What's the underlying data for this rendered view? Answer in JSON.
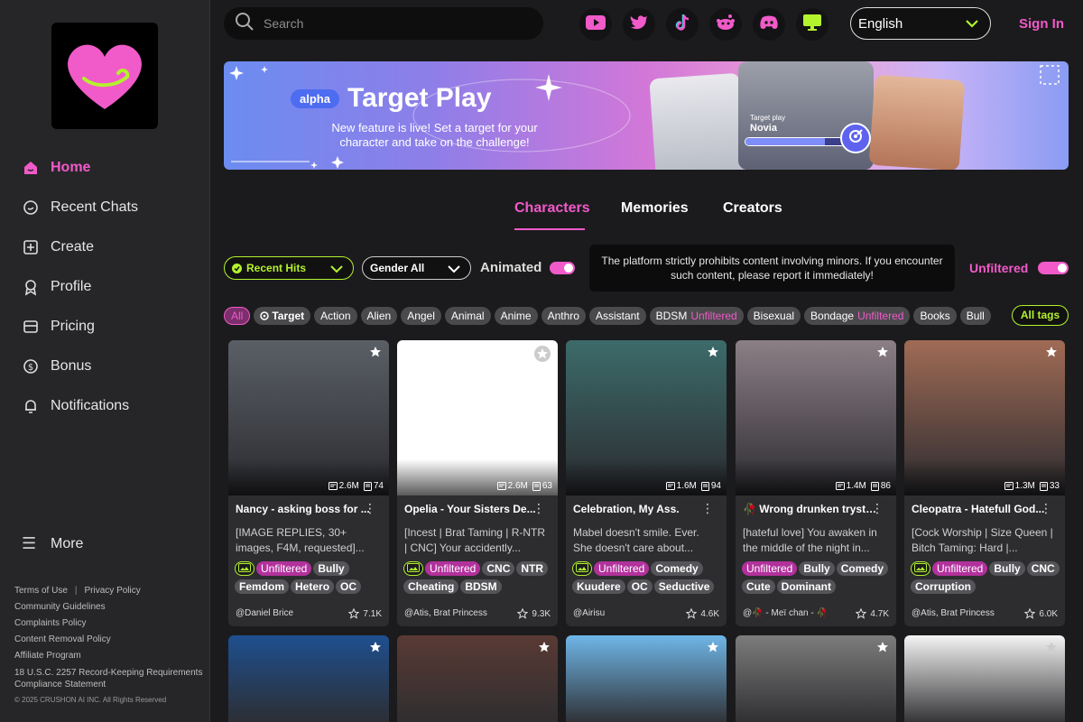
{
  "search": {
    "placeholder": "Search"
  },
  "sidebar": {
    "items": [
      {
        "label": "Home",
        "icon": "home-icon",
        "active": true
      },
      {
        "label": "Recent Chats",
        "icon": "chat-icon"
      },
      {
        "label": "Create",
        "icon": "plus-square-icon"
      },
      {
        "label": "Profile",
        "icon": "profile-icon"
      },
      {
        "label": "Pricing",
        "icon": "card-icon"
      },
      {
        "label": "Bonus",
        "icon": "dollar-icon"
      },
      {
        "label": "Notifications",
        "icon": "bell-icon"
      }
    ],
    "more_label": "More",
    "footer": {
      "terms": "Terms of Use",
      "privacy": "Privacy Policy",
      "guidelines": "Community Guidelines",
      "complaints": "Complaints Policy",
      "removal": "Content Removal Policy",
      "affiliate": "Affiliate Program",
      "usc": "18 U.S.C. 2257 Record-Keeping Requirements Compliance Statement",
      "copyright": "© 2025 CRUSHON AI INC. All Rights Reserved"
    }
  },
  "header": {
    "language": "English",
    "signin_label": "Sign In",
    "socials": [
      "youtube-icon",
      "twitter-icon",
      "tiktok-icon",
      "reddit-icon",
      "discord-icon",
      "desktop-icon"
    ]
  },
  "banner": {
    "badge": "alpha",
    "title": "Target Play",
    "subtitle": "New feature is live! Set a target for your character and take on the challenge!",
    "card_label": "Target play",
    "card_name": "Novia",
    "progress": 0.8
  },
  "tabs": [
    {
      "label": "Characters",
      "active": true
    },
    {
      "label": "Memories"
    },
    {
      "label": "Creators"
    }
  ],
  "filters": {
    "sort": "Recent Hits",
    "gender": "Gender All",
    "animated_label": "Animated",
    "animated_on": true,
    "notice": "The platform strictly prohibits content involving minors. If you encounter such content, please report it immediately!",
    "unfiltered_label": "Unfiltered",
    "unfiltered_on": true
  },
  "tags": [
    {
      "label": "All",
      "active": true
    },
    {
      "label": "Target",
      "icon": "target-icon"
    },
    {
      "label": "Action"
    },
    {
      "label": "Alien"
    },
    {
      "label": "Angel"
    },
    {
      "label": "Animal"
    },
    {
      "label": "Anime"
    },
    {
      "label": "Anthro"
    },
    {
      "label": "Assistant"
    },
    {
      "label": "BDSM",
      "suffix": "Unfiltered"
    },
    {
      "label": "Bisexual"
    },
    {
      "label": "Bondage",
      "suffix": "Unfiltered"
    },
    {
      "label": "Books"
    },
    {
      "label": "Bull"
    }
  ],
  "all_tags_label": "All tags",
  "colors": {
    "accent": "#f15ac9",
    "lime": "#b4f22e",
    "bg": "#1b1b1d",
    "sidebar": "#262628"
  },
  "cards": [
    {
      "title": "Nancy - asking boss for ...",
      "views": "2.6M",
      "chats": "74",
      "desc": "[IMAGE REPLIES, 30+ images, F4M, requested]...",
      "tags": [
        {
          "t": "img"
        },
        {
          "t": "Unfiltered",
          "k": "unf"
        },
        {
          "t": "Bully"
        },
        {
          "t": "Femdom"
        },
        {
          "t": "Hetero"
        },
        {
          "t": "OC"
        }
      ],
      "creator": "@Daniel Brice",
      "likes": "7.1K",
      "bg": "#5a5f66"
    },
    {
      "title": "Opelia - Your Sisters De...",
      "views": "2.6M",
      "chats": "63",
      "desc": "[Incest | Brat Taming | R-NTR | CNC] Your accidently...",
      "tags": [
        {
          "t": "img"
        },
        {
          "t": "Unfiltered",
          "k": "unf"
        },
        {
          "t": "CNC"
        },
        {
          "t": "NTR"
        },
        {
          "t": "Cheating"
        },
        {
          "t": "BDSM"
        }
      ],
      "creator": "@Atis, Brat Princess",
      "likes": "9.3K",
      "bg": "#ffffff"
    },
    {
      "title": "Celebration, My Ass.",
      "views": "1.6M",
      "chats": "94",
      "desc": "Mabel doesn't smile. Ever. She doesn't care about...",
      "tags": [
        {
          "t": "img"
        },
        {
          "t": "Unfiltered",
          "k": "unf"
        },
        {
          "t": "Comedy"
        },
        {
          "t": "Kuudere"
        },
        {
          "t": "OC"
        },
        {
          "t": "Seductive"
        }
      ],
      "creator": "@Airisu",
      "likes": "4.6K",
      "bg": "#3c6b6a"
    },
    {
      "title": "🥀 Wrong drunken tryst🥀",
      "views": "1.4M",
      "chats": "86",
      "desc": "[hateful love] You awaken in the middle of the night in...",
      "tags": [
        {
          "t": "Unfiltered",
          "k": "unf"
        },
        {
          "t": "Bully"
        },
        {
          "t": "Comedy"
        },
        {
          "t": "Cute"
        },
        {
          "t": "Dominant"
        }
      ],
      "creator": "@🥀 - Meï chan - 🥀",
      "likes": "4.7K",
      "bg": "#8c7f86"
    },
    {
      "title": "Cleopatra - Hatefull God...",
      "views": "1.3M",
      "chats": "33",
      "desc": "[Cock Worship | Size Queen | Bitch Taming: Hard |...",
      "tags": [
        {
          "t": "img"
        },
        {
          "t": "Unfiltered",
          "k": "unf"
        },
        {
          "t": "Bully"
        },
        {
          "t": "CNC"
        },
        {
          "t": "Corruption"
        }
      ],
      "creator": "@Atis, Brat Princess",
      "likes": "6.0K",
      "bg": "#a06b55"
    }
  ],
  "row2_colors": [
    "#1e4f8f",
    "#5a3a34",
    "#6fb6e8",
    "#7c7c7c",
    "#f4f4f4"
  ]
}
